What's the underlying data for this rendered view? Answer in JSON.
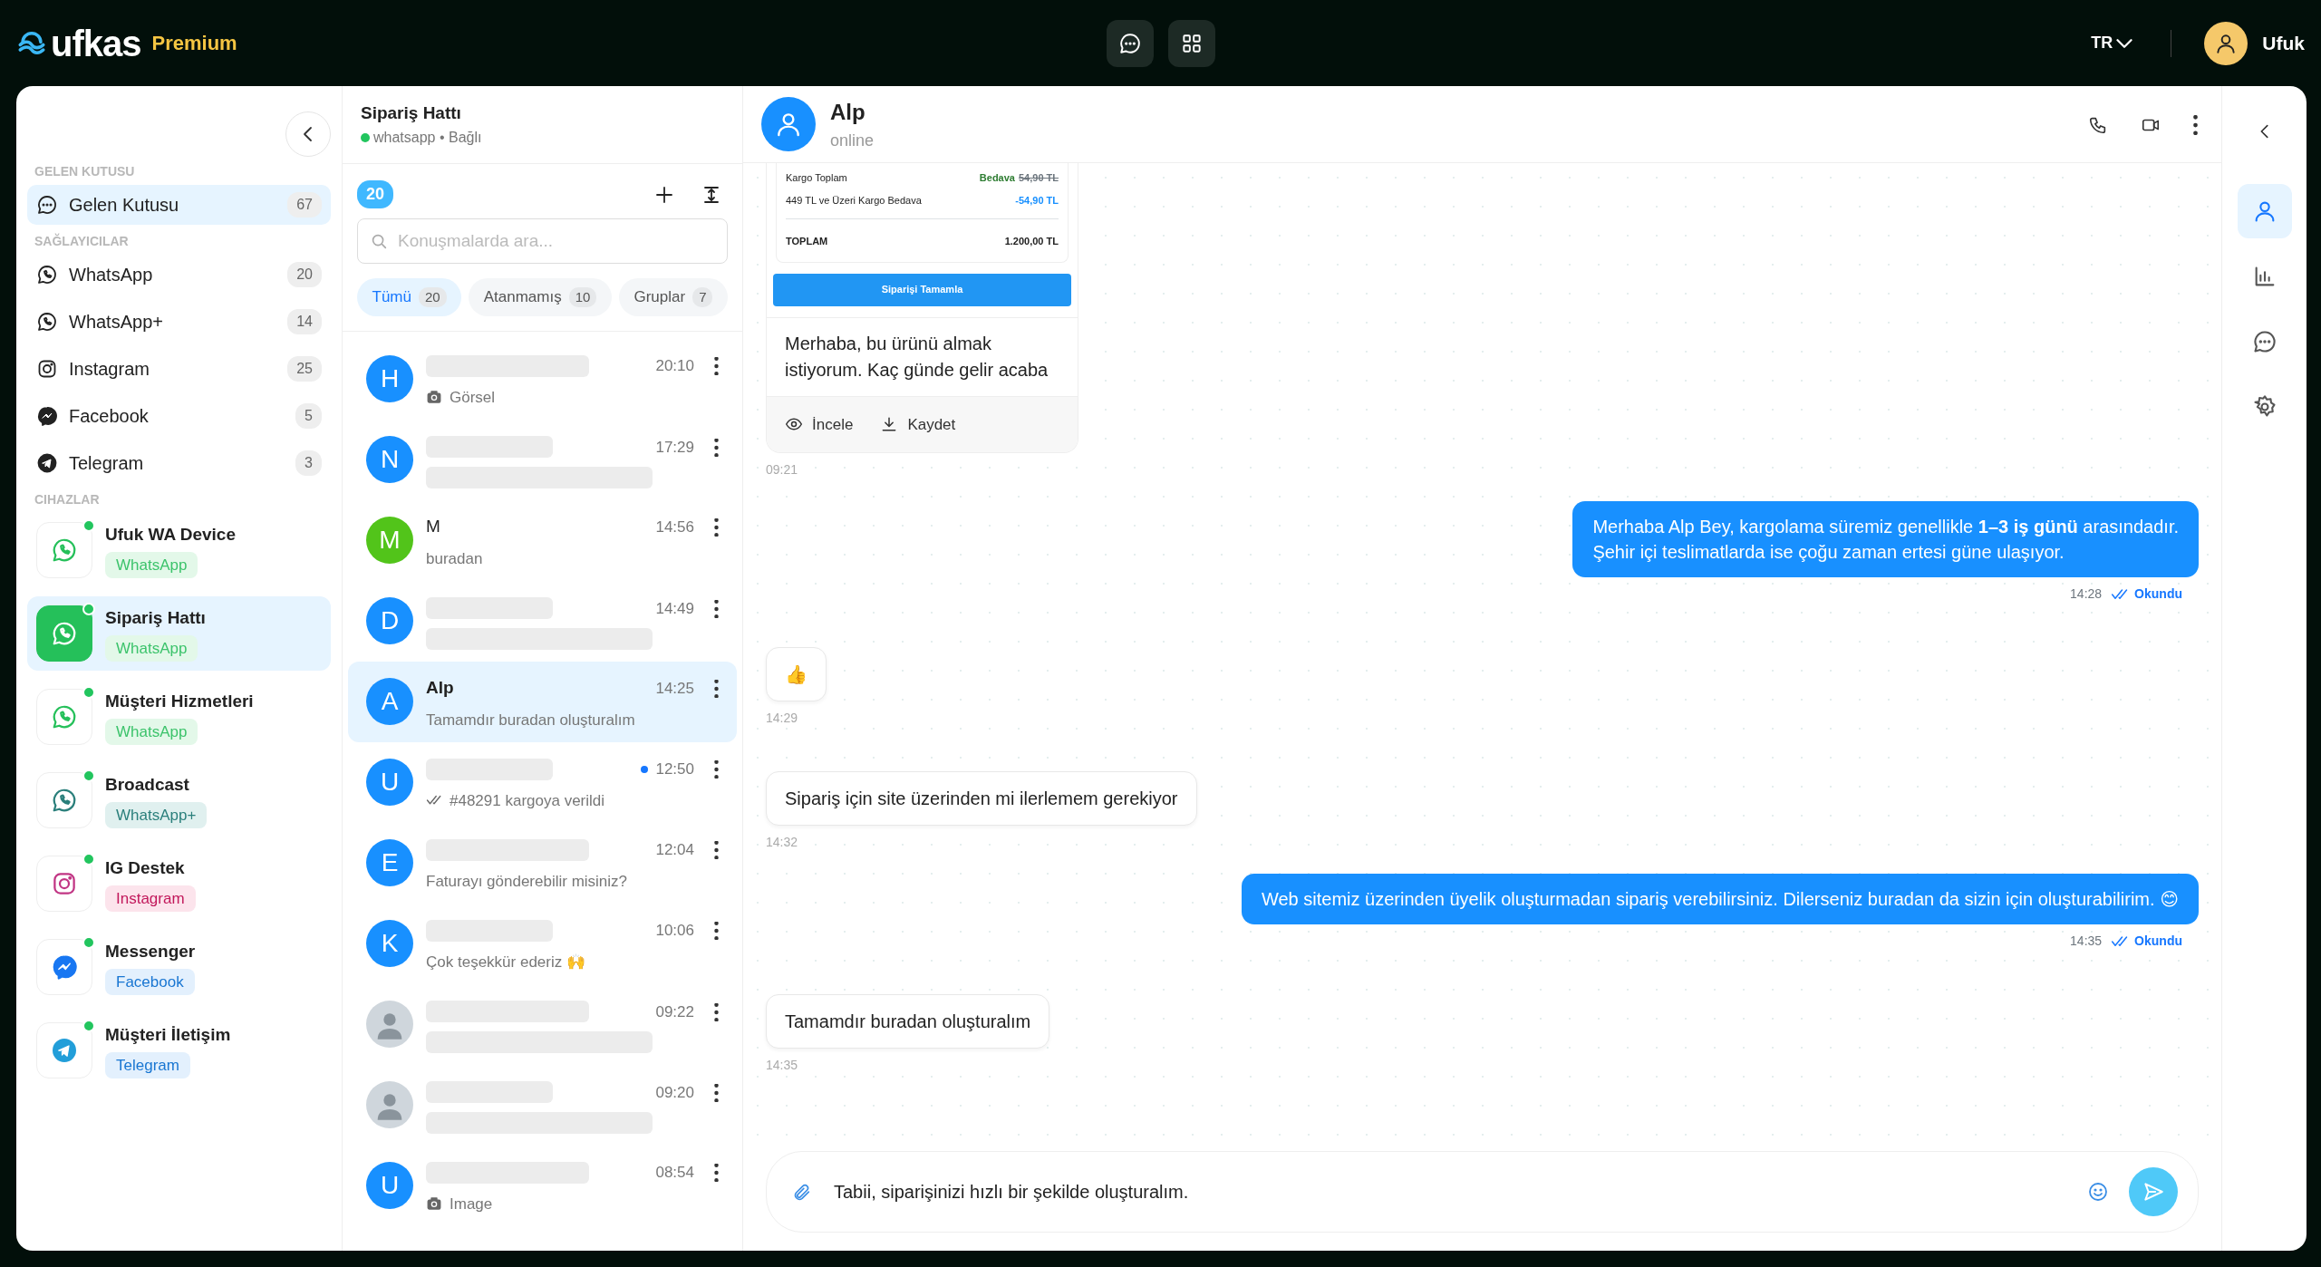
{
  "topbar": {
    "logo": "ufkas",
    "tier": "Premium",
    "language": "TR",
    "user": "Ufuk"
  },
  "sidebar": {
    "sections": [
      {
        "title": "GELEN KUTUSU",
        "items": [
          {
            "kind": "inbox",
            "label": "Gelen Kutusu",
            "count": "67",
            "selected": true
          }
        ]
      },
      {
        "title": "SAĞLAYICILAR",
        "items": [
          {
            "kind": "whatsapp",
            "label": "WhatsApp",
            "count": "20",
            "selected": false
          },
          {
            "kind": "whatsapp",
            "label": "WhatsApp+",
            "count": "14",
            "selected": false
          },
          {
            "kind": "instagram",
            "label": "Instagram",
            "count": "25",
            "selected": false
          },
          {
            "kind": "facebook",
            "label": "Facebook",
            "count": "5",
            "selected": false
          },
          {
            "kind": "telegram",
            "label": "Telegram",
            "count": "3",
            "selected": false
          }
        ]
      }
    ],
    "devices_title": "CIHAZLAR",
    "devices": [
      {
        "kind": "whatsapp",
        "name": "Ufuk WA Device",
        "tag": "WhatsApp",
        "online": true,
        "selected": false
      },
      {
        "kind": "whatsapp",
        "name": "Sipariş Hattı",
        "tag": "WhatsApp",
        "online": true,
        "selected": true
      },
      {
        "kind": "whatsapp",
        "name": "Müşteri Hizmetleri",
        "tag": "WhatsApp",
        "online": true,
        "selected": false
      },
      {
        "kind": "whatsapp_plus",
        "name": "Broadcast",
        "tag": "WhatsApp+",
        "online": true,
        "selected": false
      },
      {
        "kind": "instagram",
        "name": "IG Destek",
        "tag": "Instagram",
        "online": true,
        "selected": false
      },
      {
        "kind": "facebook",
        "name": "Messenger",
        "tag": "Facebook",
        "online": true,
        "selected": false
      },
      {
        "kind": "telegram",
        "name": "Müşteri İletişim",
        "tag": "Telegram",
        "online": true,
        "selected": false
      }
    ]
  },
  "conversations": {
    "title": "Sipariş Hattı",
    "status": "whatsapp • Bağlı",
    "connected": true,
    "total": "20",
    "search": {
      "placeholder": "Konuşmalarda ara..."
    },
    "filters": [
      {
        "label": "Tümü",
        "count": "20",
        "selected": true
      },
      {
        "label": "Atanmamış",
        "count": "10",
        "selected": false
      },
      {
        "label": "Gruplar",
        "count": "7",
        "selected": false
      }
    ],
    "items": [
      {
        "kind": "letter",
        "initial": "H",
        "color": "#1890ff",
        "time": "20:10",
        "preview": "Görsel",
        "attachment": true,
        "read": false,
        "unread": false,
        "selected": false
      },
      {
        "kind": "letter",
        "initial": "N",
        "color": "#1890ff",
        "time": "17:29",
        "unread": false,
        "selected": false
      },
      {
        "kind": "letter",
        "initial": "M",
        "color": "#52c41a",
        "name": "M",
        "time": "14:56",
        "preview": "buradan",
        "attachment": false,
        "read": false,
        "unread": false,
        "selected": false
      },
      {
        "kind": "letter",
        "initial": "D",
        "color": "#1890ff",
        "time": "14:49",
        "unread": false,
        "selected": false
      },
      {
        "kind": "letter",
        "initial": "A",
        "color": "#1890ff",
        "name": "Alp",
        "time": "14:25",
        "preview": "Tamamdır buradan oluşturalım",
        "attachment": false,
        "read": false,
        "unread": false,
        "selected": true
      },
      {
        "kind": "letter",
        "initial": "U",
        "color": "#1890ff",
        "time": "12:50",
        "preview": "#48291 kargoya verildi",
        "attachment": false,
        "read": true,
        "unread": true,
        "selected": false
      },
      {
        "kind": "letter",
        "initial": "E",
        "color": "#1890ff",
        "time": "12:04",
        "preview": "Faturayı gönderebilir misiniz?",
        "attachment": false,
        "read": false,
        "unread": false,
        "selected": false
      },
      {
        "kind": "letter",
        "initial": "K",
        "color": "#1890ff",
        "time": "10:06",
        "preview": "Çok teşekkür ederiz 🙌",
        "attachment": false,
        "read": false,
        "unread": false,
        "selected": false
      },
      {
        "kind": "photo",
        "time": "09:22",
        "unread": false,
        "selected": false
      },
      {
        "kind": "photo",
        "time": "09:20",
        "unread": false,
        "selected": false
      },
      {
        "kind": "letter",
        "initial": "U",
        "color": "#1890ff",
        "time": "08:54",
        "preview": "Image",
        "attachment": true,
        "read": false,
        "unread": false,
        "selected": false
      }
    ]
  },
  "chat": {
    "contact": {
      "name": "Alp",
      "status": "online"
    },
    "messages": [
      {
        "kind": "order",
        "rows": [
          {
            "kind": "free",
            "label": "Kargo Toplam",
            "value": "Bedava",
            "old_value": "54,90 TL"
          },
          {
            "kind": "discount",
            "label": "449 TL ve Üzeri Kargo Bedava",
            "value": "-54,90 TL"
          },
          {
            "kind": "total",
            "label": "TOPLAM",
            "value": "1.200,00 TL"
          }
        ],
        "button": "Siparişi Tamamla",
        "text": "Merhaba, bu ürünü almak istiyorum. Kaç günde gelir acaba",
        "actions": [
          {
            "kind": "view",
            "label": "İncele"
          },
          {
            "kind": "download",
            "label": "Kaydet"
          }
        ],
        "time": "09:21"
      },
      {
        "kind": "out",
        "text": "Merhaba Alp Bey, kargolama süremiz genellikle **1–3 iş günü** arasındadır.\nŞehir içi teslimatlarda ise çoğu zaman ertesi güne ulaşıyor.",
        "time": "14:28",
        "status": "Okundu"
      },
      {
        "kind": "in",
        "text": "👍",
        "time": "14:29"
      },
      {
        "kind": "in",
        "text": "Sipariş için site üzerinden mi ilerlemem gerekiyor",
        "time": "14:32"
      },
      {
        "kind": "out",
        "text": "Web sitemiz üzerinden üyelik oluşturmadan sipariş verebilirsiniz. Dilerseniz buradan da sizin için oluşturabilirim. 😊",
        "time": "14:35",
        "status": "Okundu"
      },
      {
        "kind": "in",
        "text": "Tamamdır buradan oluşturalım",
        "time": "14:35"
      }
    ],
    "composer": {
      "value": "Tabii, siparişinizi hızlı bir şekilde oluşturalım."
    }
  },
  "rail": [
    {
      "kind": "person",
      "selected": true
    },
    {
      "kind": "chart",
      "selected": false
    },
    {
      "kind": "chat",
      "selected": false
    },
    {
      "kind": "gear",
      "selected": false
    }
  ]
}
